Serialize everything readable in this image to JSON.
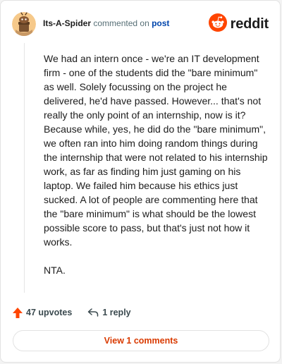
{
  "comment": {
    "username": "Its-A-Spider",
    "action_text": "commented on",
    "post_link": "post",
    "paragraphs": [
      "We had an intern once - we're an IT development firm - one of the students did the \"bare minimum\" as well. Solely focussing on the project he delivered, he'd have passed. However... that's not really the only point of an internship, now is it? Because while, yes, he did do the \"bare minimum\", we often ran into him doing random things during the internship that were not related to his internship work, as far as finding him just gaming on his laptop. We failed him because his ethics just sucked. A lot of people are commenting here that the \"bare minimum\" is what should be the lowest possible score to pass, but that's just not how it works.",
      "NTA."
    ],
    "upvotes": "47 upvotes",
    "replies": "1 reply"
  },
  "brand": {
    "name": "reddit",
    "icon": "reddit-logo-icon"
  },
  "view_comments_label": "View 1 comments",
  "colors": {
    "upvote": "#ff4500",
    "link": "#0045ac",
    "view_button_text": "#d93a00",
    "reddit_orange": "#ff4500"
  },
  "icons": {
    "avatar": "snoo-avatar-icon",
    "upvote": "upvote-arrow-icon",
    "reply": "reply-arrow-icon"
  }
}
